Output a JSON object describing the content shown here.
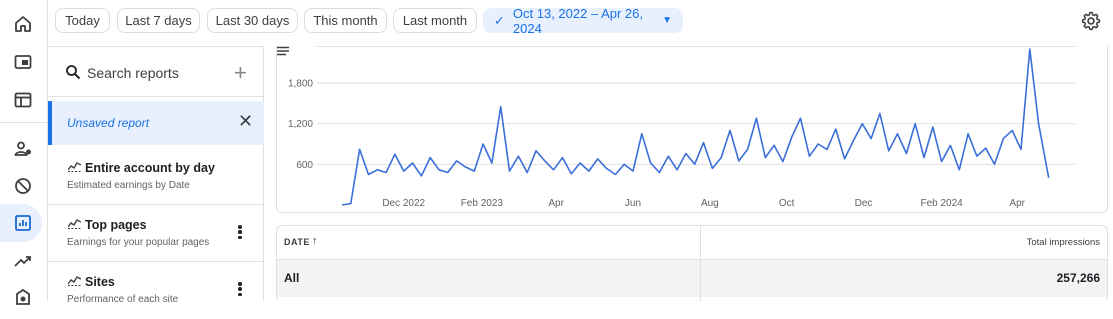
{
  "date_filters": {
    "today": "Today",
    "last_7_days": "Last 7 days",
    "last_30_days": "Last 30 days",
    "this_month": "This month",
    "last_month": "Last month",
    "selected_range": "Oct 13, 2022 – Apr 26, 2024"
  },
  "reports_panel": {
    "search_placeholder": "Search reports",
    "unsaved_label": "Unsaved report",
    "reports": [
      {
        "title": "Entire account by day",
        "subtitle": "Estimated earnings by Date"
      },
      {
        "title": "Top pages",
        "subtitle": "Earnings for your popular pages"
      },
      {
        "title": "Sites",
        "subtitle": "Performance of each site"
      }
    ]
  },
  "colors": {
    "accent": "#1a73e8",
    "line": "#3b6fd9",
    "selected_bg": "#e8f0fe"
  },
  "chart_data": {
    "type": "line",
    "y_ticks": [
      "600",
      "1,200",
      "1,800"
    ],
    "x_ticks": [
      "Dec 2022",
      "Feb 2023",
      "Apr",
      "Jun",
      "Aug",
      "Oct",
      "Dec",
      "Feb 2024",
      "Apr"
    ],
    "ylim": [
      0,
      2400
    ],
    "series": [
      {
        "name": "Total impressions",
        "x": [
          "2022-10-13",
          "2022-10-20",
          "2022-10-27",
          "2022-11-03",
          "2022-11-10",
          "2022-11-17",
          "2022-11-24",
          "2022-12-01",
          "2022-12-08",
          "2022-12-15",
          "2022-12-22",
          "2022-12-29",
          "2023-01-05",
          "2023-01-12",
          "2023-01-19",
          "2023-01-26",
          "2023-02-02",
          "2023-02-09",
          "2023-02-16",
          "2023-02-23",
          "2023-03-02",
          "2023-03-09",
          "2023-03-16",
          "2023-03-23",
          "2023-03-30",
          "2023-04-06",
          "2023-04-13",
          "2023-04-20",
          "2023-04-27",
          "2023-05-04",
          "2023-05-11",
          "2023-05-18",
          "2023-05-25",
          "2023-06-01",
          "2023-06-08",
          "2023-06-15",
          "2023-06-22",
          "2023-06-29",
          "2023-07-06",
          "2023-07-13",
          "2023-07-20",
          "2023-07-27",
          "2023-08-03",
          "2023-08-10",
          "2023-08-17",
          "2023-08-24",
          "2023-08-31",
          "2023-09-07",
          "2023-09-14",
          "2023-09-21",
          "2023-09-28",
          "2023-10-05",
          "2023-10-12",
          "2023-10-19",
          "2023-10-26",
          "2023-11-02",
          "2023-11-09",
          "2023-11-16",
          "2023-11-23",
          "2023-11-30",
          "2023-12-07",
          "2023-12-14",
          "2023-12-21",
          "2023-12-28",
          "2024-01-04",
          "2024-01-11",
          "2024-01-18",
          "2024-01-25",
          "2024-02-01",
          "2024-02-08",
          "2024-02-15",
          "2024-02-22",
          "2024-02-29",
          "2024-03-07",
          "2024-03-14",
          "2024-03-21",
          "2024-03-28",
          "2024-04-04",
          "2024-04-11",
          "2024-04-18",
          "2024-04-26"
        ],
        "values": [
          0,
          20,
          820,
          450,
          520,
          480,
          750,
          500,
          620,
          430,
          700,
          520,
          480,
          650,
          560,
          500,
          900,
          620,
          1450,
          500,
          720,
          480,
          800,
          650,
          520,
          700,
          460,
          620,
          500,
          680,
          540,
          450,
          600,
          500,
          1050,
          620,
          480,
          720,
          520,
          760,
          600,
          920,
          540,
          700,
          1100,
          650,
          820,
          1280,
          700,
          880,
          640,
          1000,
          1280,
          720,
          900,
          820,
          1120,
          680,
          950,
          1200,
          980,
          1350,
          800,
          1050,
          760,
          1200,
          700,
          1150,
          640,
          880,
          520,
          1050,
          720,
          840,
          600,
          980,
          1100,
          820,
          2300,
          1200,
          400
        ]
      }
    ]
  },
  "table": {
    "col_date": "DATE",
    "col_impressions": "Total impressions",
    "total_label": "All",
    "total_value": "257,266"
  }
}
